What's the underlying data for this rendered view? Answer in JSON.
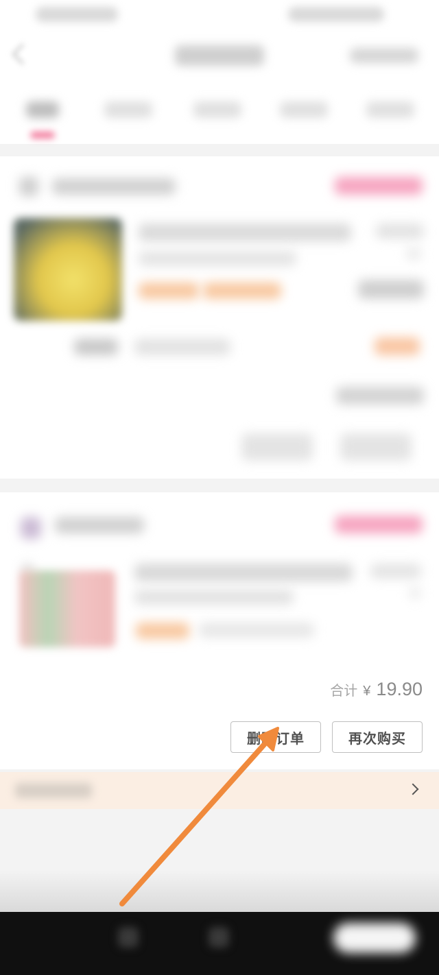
{
  "order2": {
    "total_label": "合计",
    "total_currency": "¥",
    "total_amount": "19.90",
    "delete_button": "删除订单",
    "rebuy_button": "再次购买"
  },
  "colors": {
    "annotation_arrow": "#f08a3c",
    "info_bar_bg": "#fbeee3",
    "status_pink": "#f6a4c0",
    "tag_orange": "#f8c8a0"
  },
  "icons": {
    "back": "back-arrow-icon",
    "chevron": "chevron-right-icon",
    "annotation": "arrow-annotation-icon"
  }
}
